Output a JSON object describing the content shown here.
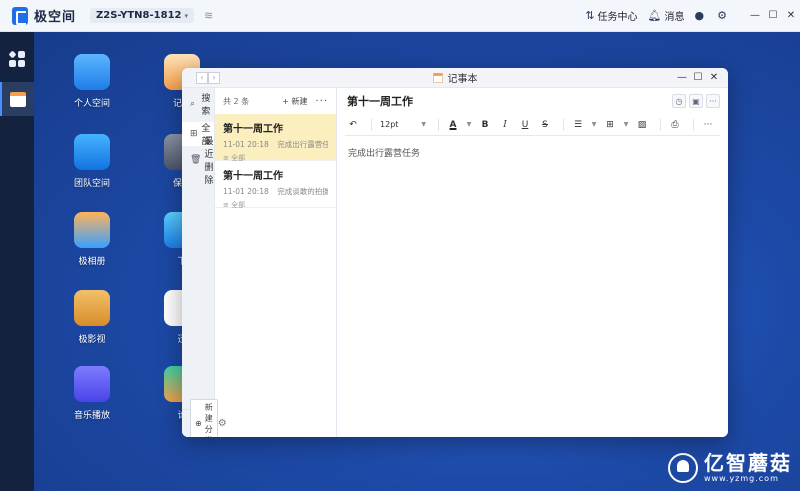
{
  "topbar": {
    "brand": "极空间",
    "device": "Z2S-YTN8-1812",
    "task_center": "任务中心",
    "messages": "消息"
  },
  "desktop": {
    "icons": [
      {
        "label": "个人空间",
        "icon": "folder-icon"
      },
      {
        "label": "团队空间",
        "icon": "team-folder-icon"
      },
      {
        "label": "极相册",
        "icon": "photo-album-icon"
      },
      {
        "label": "极影视",
        "icon": "video-icon"
      },
      {
        "label": "音乐播放",
        "icon": "music-icon"
      },
      {
        "label": "记事",
        "icon": "notepad-icon"
      },
      {
        "label": "保险",
        "icon": "safe-icon"
      },
      {
        "label": "下",
        "icon": "download-icon"
      },
      {
        "label": "迅",
        "icon": "xunlei-icon"
      },
      {
        "label": "论",
        "icon": "forum-icon"
      }
    ]
  },
  "window": {
    "title": "记事本"
  },
  "sidebar": {
    "search": "搜索",
    "all": "全部",
    "recently_deleted": "最近删除",
    "new_category": "新建分类"
  },
  "list": {
    "count": "共 2 条",
    "new_label": "+ 新建",
    "notes": [
      {
        "title": "第十一周工作",
        "time": "11-01 20:18",
        "preview": "完成出行露营任务",
        "category": "全部"
      },
      {
        "title": "第十一周工作",
        "time": "11-01 20:18",
        "preview": "完成谈敢的拍摄任务",
        "category": "全部"
      }
    ]
  },
  "editor": {
    "title": "第十一周工作",
    "font_size": "12pt",
    "content": "完成出行露营任务"
  },
  "watermark": {
    "big": "亿智蘑菇",
    "small": "www.yzmg.com"
  }
}
